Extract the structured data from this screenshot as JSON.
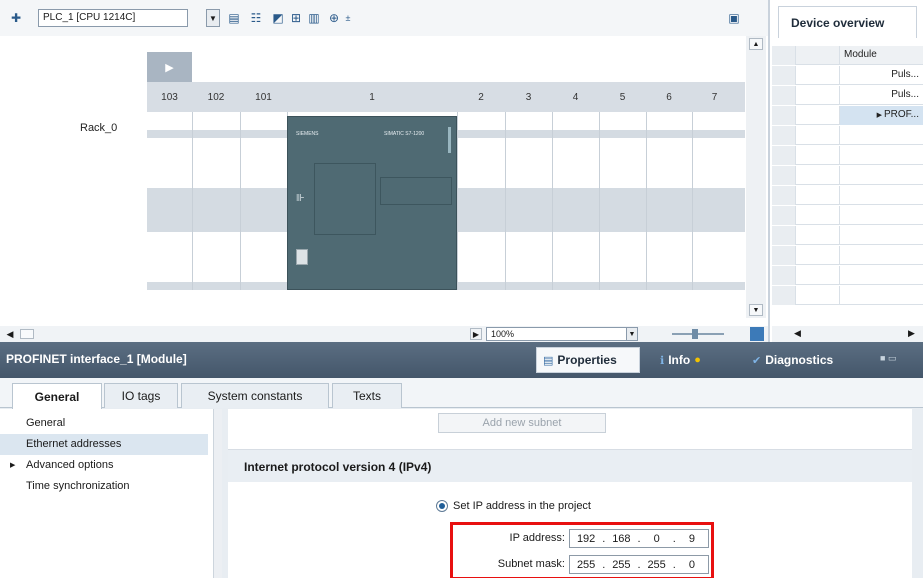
{
  "device_view": {
    "device_selector": "PLC_1 [CPU 1214C]",
    "slots": [
      "103",
      "102",
      "101",
      "1",
      "2",
      "3",
      "4",
      "5",
      "6",
      "7"
    ],
    "rack_label": "Rack_0",
    "zoom": "100%",
    "toolbar_icons": [
      "network-icon",
      "device-view-icon",
      "topology-icon",
      "show-modules-icon",
      "grid-icon",
      "table-icon",
      "zoom-icon"
    ],
    "cpu_module": {
      "brand": "SIEMENS",
      "model": "SIMATIC S7-1200"
    }
  },
  "device_overview": {
    "tab": "Device overview",
    "column_module": "Module",
    "rows": [
      "Puls...",
      "Puls...",
      "PROF..."
    ]
  },
  "properties": {
    "title": "PROFINET interface_1 [Module]",
    "tabs": {
      "properties": "Properties",
      "info": "Info",
      "diagnostics": "Diagnostics"
    },
    "sub_tabs": [
      "General",
      "IO tags",
      "System constants",
      "Texts"
    ],
    "nav": [
      "General",
      "Ethernet addresses",
      "Advanced options",
      "Time synchronization"
    ],
    "add_subnet": "Add new subnet",
    "ipv4_header": "Internet protocol version 4 (IPv4)",
    "set_ip_label": "Set IP address in the project",
    "ip_address_label": "IP address:",
    "ip_octets": [
      "192",
      "168",
      "0",
      "9"
    ],
    "subnet_mask_label": "Subnet mask:",
    "subnet_octets": [
      "255",
      "255",
      "255",
      "0"
    ]
  },
  "colors": {
    "highlight_box": "#e81010",
    "header_bar": "#4e6176"
  }
}
